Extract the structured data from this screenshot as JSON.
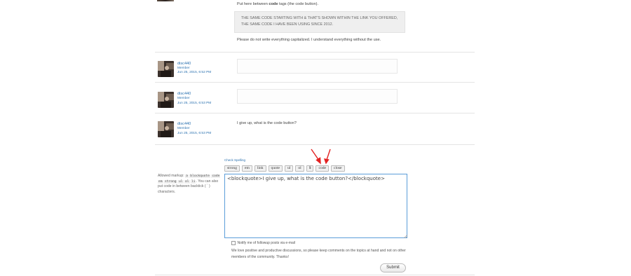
{
  "top_post": {
    "line1_pre": "Put here between ",
    "line1_bold": "code",
    "line1_post": " tags (the code button).",
    "quote": "THE SAME CODE STARTING WITH & THAT'S SHOWN WITHIN THE LINK YOU OFFERED, THE SAME CODE I HAVE BEEN USING SINCE 2012.",
    "warning": "Please do not write everything capitalized. I understand everything without the use."
  },
  "replies": [
    {
      "username": "disc440",
      "role": "Member",
      "date": "Jun 25, 2015, 6:52 PM",
      "body": ""
    },
    {
      "username": "disc440",
      "role": "Member",
      "date": "Jun 25, 2015, 6:53 PM",
      "body": ""
    },
    {
      "username": "disc440",
      "role": "Member",
      "date": "Jun 25, 2015, 6:53 PM",
      "body": "I give up, what is the code button?"
    }
  ],
  "form": {
    "spell_check": "Check Spelling",
    "toolbar": [
      "strong",
      "em",
      "link",
      "quote",
      "ul",
      "ol",
      "$",
      "code",
      "close"
    ],
    "allowed_prefix": "Allowed markup:",
    "allowed_tags": [
      "a",
      "blockquote",
      "code",
      "em",
      "strong",
      "ul",
      "ol",
      "li"
    ],
    "allowed_suffix": "You can also put code in between backtick ( ` ) characters.",
    "textarea_value": "<blockquote>I give up, what is the code button?</blockquote>",
    "notify_label": "Notify me of followup posts via e-mail",
    "policy": "We love positive and productive discussions, so please keep comments on the topics at hand and not on other members of the community. Thanks!",
    "submit_label": "Submit"
  },
  "colors": {
    "link": "#2c72b0",
    "annotation_arrow": "#e32222",
    "textarea_focus": "#5b9dd9"
  }
}
